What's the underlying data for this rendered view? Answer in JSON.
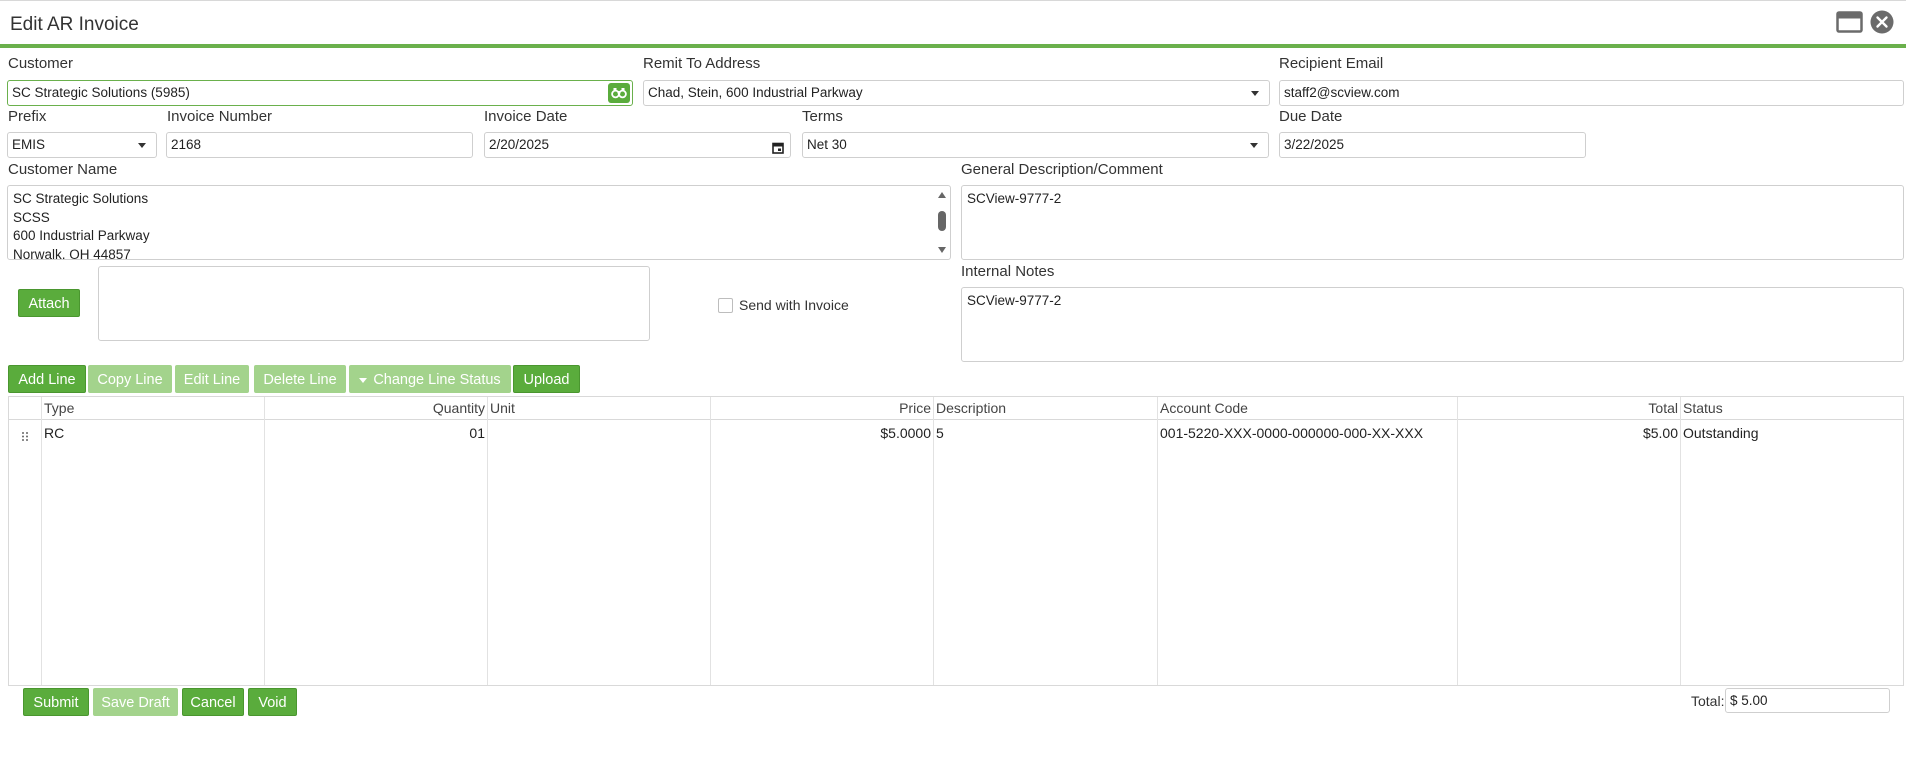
{
  "window": {
    "title": "Edit AR Invoice",
    "icons": [
      "maximize-icon",
      "close-icon"
    ]
  },
  "customer": {
    "label": "Customer",
    "value": "SC Strategic Solutions (5985)",
    "lookup_icon": "binoculars-icon"
  },
  "remit": {
    "label": "Remit To Address",
    "value": "Chad, Stein, 600 Industrial Parkway"
  },
  "recipient": {
    "label": "Recipient Email",
    "value": "staff2@scview.com"
  },
  "prefix": {
    "label": "Prefix",
    "value": "EMIS"
  },
  "invoice_number": {
    "label": "Invoice Number",
    "value": "2168"
  },
  "invoice_date": {
    "label": "Invoice Date",
    "value": "2/20/2025",
    "icon": "calendar-icon"
  },
  "terms": {
    "label": "Terms",
    "value": "Net 30"
  },
  "due_date": {
    "label": "Due Date",
    "value": "3/22/2025"
  },
  "customer_name": {
    "label": "Customer Name",
    "lines": [
      "SC Strategic Solutions",
      "SCSS",
      "600 Industrial Parkway",
      "Norwalk, OH 44857"
    ]
  },
  "general_desc": {
    "label": "General Description/Comment",
    "value": "SCView-9777-2"
  },
  "internal_notes": {
    "label": "Internal Notes",
    "value": "SCView-9777-2"
  },
  "attach": {
    "button": "Attach",
    "send_with_invoice": "Send with Invoice",
    "send_checked": false
  },
  "toolbar": {
    "add_line": "Add Line",
    "copy_line": "Copy Line",
    "edit_line": "Edit Line",
    "delete_line": "Delete Line",
    "change_status": "Change Line Status",
    "upload": "Upload"
  },
  "grid": {
    "columns": [
      "Type",
      "Quantity",
      "Unit",
      "Price",
      "Description",
      "Account Code",
      "Total",
      "Status"
    ],
    "rows": [
      {
        "type": "RC",
        "quantity": "01",
        "unit": "",
        "price": "$5.0000",
        "description": "5",
        "account_code": "001-5220-XXX-0000-000000-000-XX-XXX",
        "total": "$5.00",
        "status": "Outstanding"
      }
    ]
  },
  "footer": {
    "submit": "Submit",
    "save_draft": "Save Draft",
    "cancel": "Cancel",
    "void": "Void",
    "total_label": "Total:",
    "total_value": "$ 5.00"
  },
  "colors": {
    "accent": "#6ab04c",
    "button": "#5aac3c",
    "button_disabled": "#a3d38c"
  }
}
